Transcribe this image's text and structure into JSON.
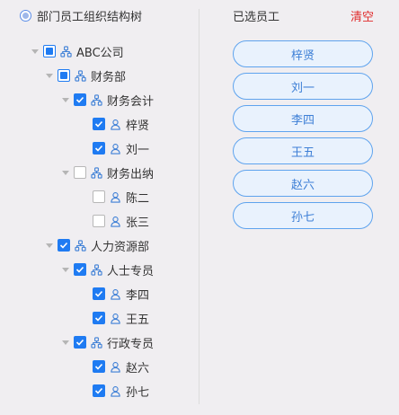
{
  "tree": {
    "title": "部门员工组织结构树",
    "nodes": [
      {
        "label": "ABC公司",
        "state": "partial",
        "kind": "org"
      },
      {
        "label": "财务部",
        "state": "partial",
        "kind": "org"
      },
      {
        "label": "财务会计",
        "state": "checked",
        "kind": "org"
      },
      {
        "label": "梓贤",
        "state": "checked",
        "kind": "person"
      },
      {
        "label": "刘一",
        "state": "checked",
        "kind": "person"
      },
      {
        "label": "财务出纳",
        "state": "unchecked",
        "kind": "org"
      },
      {
        "label": "陈二",
        "state": "unchecked",
        "kind": "person"
      },
      {
        "label": "张三",
        "state": "unchecked",
        "kind": "person"
      },
      {
        "label": "人力资源部",
        "state": "checked",
        "kind": "org"
      },
      {
        "label": "人士专员",
        "state": "checked",
        "kind": "org"
      },
      {
        "label": "李四",
        "state": "checked",
        "kind": "person"
      },
      {
        "label": "王五",
        "state": "checked",
        "kind": "person"
      },
      {
        "label": "行政专员",
        "state": "checked",
        "kind": "org"
      },
      {
        "label": "赵六",
        "state": "checked",
        "kind": "person"
      },
      {
        "label": "孙七",
        "state": "checked",
        "kind": "person"
      }
    ]
  },
  "selected": {
    "title": "已选员工",
    "clear_label": "清空",
    "items": [
      "梓贤",
      "刘一",
      "李四",
      "王五",
      "赵六",
      "孙七"
    ]
  },
  "colors": {
    "accent": "#1f7bf2",
    "chip_border": "#5ea3ee",
    "chip_bg": "#e9f2fd",
    "danger": "#e02a2a"
  }
}
